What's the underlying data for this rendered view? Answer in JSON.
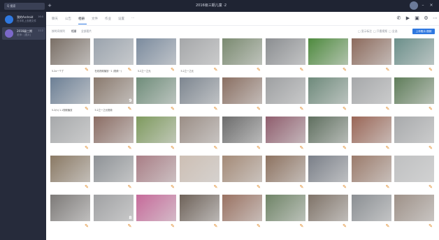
{
  "window": {
    "title": "2016级三期儿童 ·2"
  },
  "search": {
    "placeholder": "Q 搜索"
  },
  "sidebar": {
    "conversations": [
      {
        "name": "我的Android",
        "sub": "在手机上查看文件",
        "time": "16:0"
      },
      {
        "name": "2016级三期",
        "sub": "老师：[图片]",
        "time": "11:2"
      }
    ]
  },
  "tabs": [
    "聊天",
    "公告",
    "相册",
    "文件",
    "作业",
    "设置",
    "···"
  ],
  "subtabs": [
    "按时间排列",
    "相册",
    "全部图片"
  ],
  "toolbar_options": [
    "□ 显示标注",
    "□ 只看视频",
    "□ 全选"
  ],
  "upload_label": "上传照片/视频",
  "icons": {
    "phone": "phone-icon",
    "video": "video-icon",
    "screen": "screen-share-icon",
    "settings": "settings-icon",
    "more": "more-icon"
  },
  "rows": [
    {
      "items": [
        {
          "label": "5.2x一个了",
          "dur": "",
          "color": "#7a6f66"
        },
        {
          "label": "在线视频播放···1 (视频···)",
          "dur": "",
          "color": "#9aa3ad"
        },
        {
          "label": "5.2之一之元",
          "dur": "",
          "color": "#7b8b9e"
        },
        {
          "label": "5.2之一之元",
          "dur": "",
          "color": "#a5a7a9"
        },
        {
          "label": "",
          "dur": "",
          "color": "#7a8a70"
        },
        {
          "label": "",
          "dur": "",
          "color": "#8b8e91"
        },
        {
          "label": "",
          "dur": "",
          "color": "#4e8a3e"
        },
        {
          "label": "",
          "dur": "",
          "color": "#8c6a5c"
        },
        {
          "label": "",
          "dur": "",
          "color": "#6b8f8a"
        }
      ]
    },
    {
      "items": [
        {
          "label": "5.2(h) 1.1视频播放",
          "dur": "",
          "color": "#6c7f95"
        },
        {
          "label": "5.2之一之元视频",
          "dur": "9",
          "color": "#8a7a6e"
        },
        {
          "label": "",
          "dur": "",
          "color": "#6f8d7a"
        },
        {
          "label": "",
          "dur": "",
          "color": "#7d8690"
        },
        {
          "label": "",
          "dur": "",
          "color": "#8a6f62"
        },
        {
          "label": "",
          "dur": "",
          "color": "#9ea0a2"
        },
        {
          "label": "",
          "dur": "",
          "color": "#6e8a7b"
        },
        {
          "label": "",
          "dur": "",
          "color": "#a6a8aa"
        },
        {
          "label": "",
          "dur": "",
          "color": "#5f7d5a"
        }
      ]
    },
    {
      "items": [
        {
          "label": "",
          "dur": "",
          "color": "#a7a9ab"
        },
        {
          "label": "",
          "dur": "",
          "color": "#8b6d64"
        },
        {
          "label": "",
          "dur": "",
          "color": "#7e9a5e"
        },
        {
          "label": "",
          "dur": "",
          "color": "#9b8e86"
        },
        {
          "label": "",
          "dur": "",
          "color": "#6c6c6c"
        },
        {
          "label": "",
          "dur": "",
          "color": "#8f5d6d"
        },
        {
          "label": "",
          "dur": "",
          "color": "#5f6f5f"
        },
        {
          "label": "",
          "dur": "",
          "color": "#9a6656"
        },
        {
          "label": "",
          "dur": "",
          "color": "#a8aaac"
        }
      ]
    },
    {
      "items": [
        {
          "label": "",
          "dur": "",
          "color": "#8a7964"
        },
        {
          "label": "",
          "dur": "",
          "color": "#8e9296"
        },
        {
          "label": "",
          "dur": "",
          "color": "#a97e86"
        },
        {
          "label": "",
          "dur": "",
          "color": "#cdbfb4"
        },
        {
          "label": "",
          "dur": "",
          "color": "#a48a77"
        },
        {
          "label": "",
          "dur": "",
          "color": "#8d7260"
        },
        {
          "label": "",
          "dur": "",
          "color": "#7a7f88"
        },
        {
          "label": "",
          "dur": "",
          "color": "#9b7b6b"
        },
        {
          "label": "",
          "dur": "",
          "color": "#bfc0c1"
        }
      ]
    },
    {
      "items": [
        {
          "label": "",
          "dur": "",
          "color": "#7d7a78"
        },
        {
          "label": "",
          "dur": "8",
          "color": "#a0a1a3"
        },
        {
          "label": "",
          "dur": "",
          "color": "#c66a9a"
        },
        {
          "label": "",
          "dur": "",
          "color": "#6e6259"
        },
        {
          "label": "",
          "dur": "",
          "color": "#9a7262"
        },
        {
          "label": "",
          "dur": "",
          "color": "#6f8467"
        },
        {
          "label": "",
          "dur": "",
          "color": "#7f7368"
        },
        {
          "label": "",
          "dur": "",
          "color": "#8b8f93"
        },
        {
          "label": "",
          "dur": "",
          "color": "#9e9188"
        }
      ]
    }
  ]
}
